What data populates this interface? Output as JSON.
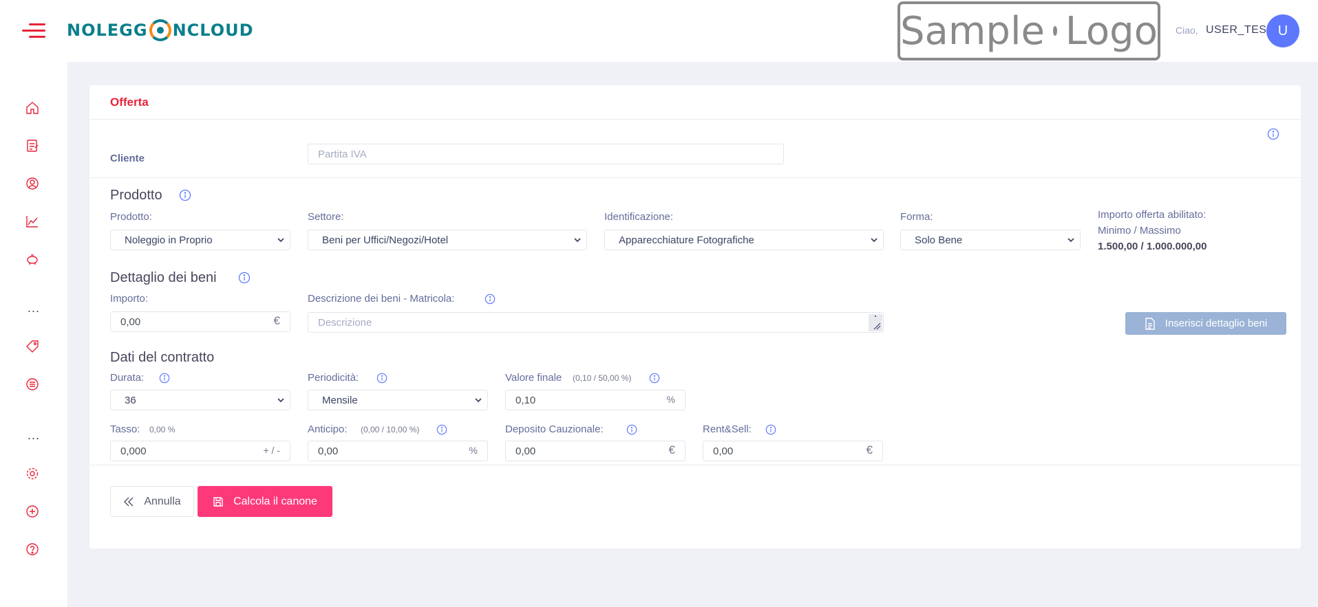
{
  "header": {
    "brand": "NOLEGG",
    "brand_end": "NCLOUD",
    "sample_logo_left": "Sample",
    "sample_logo_right": "Logo",
    "greeting": "Ciao,",
    "username": "USER_TEST",
    "avatar_letter": "U",
    "accent": "#e8233a",
    "avatar_color": "#5d78ff"
  },
  "sidebar": {
    "icons": [
      "home-icon",
      "orders-icon",
      "customer-icon",
      "chart-icon",
      "piggy-bank-icon",
      "more-icon",
      "tag-icon",
      "list-icon",
      "more-icon",
      "settings-icon",
      "add-circle-icon",
      "help-icon"
    ],
    "dots": "..."
  },
  "card": {
    "title": "Offerta",
    "cliente_label": "Cliente",
    "partita_iva_placeholder": "Partita IVA",
    "prodotto_section": "Prodotto",
    "prodotto_label": "Prodotto:",
    "prodotto_value": "Noleggio in Proprio",
    "settore_label": "Settore:",
    "settore_value": "Beni per Uffici/Negozi/Hotel",
    "identificazione_label": "Identificazione:",
    "identificazione_value": "Apparecchiature Fotografiche",
    "forma_label": "Forma:",
    "forma_value": "Solo Bene",
    "importo_abilitato_label": "Importo offerta abilitato:",
    "min_max_label": "Minimo / Massimo",
    "min_max_value": "1.500,00 / 1.000.000,00",
    "dettaglio_section": "Dettaglio dei beni",
    "importo_label": "Importo:",
    "importo_value": "0,00",
    "euro": "€",
    "descrizione_label": "Descrizione dei beni - Matricola:",
    "descrizione_placeholder": "Descrizione",
    "inserisci_button": "Inserisci dettaglio beni",
    "contratto_section": "Dati del contratto",
    "durata_label": "Durata:",
    "durata_value": "36",
    "periodicita_label": "Periodicità:",
    "periodicita_value": "Mensile",
    "valore_finale_label": "Valore finale",
    "valore_finale_range": "(0,10 / 50,00 %)",
    "valore_finale_value": "0,10",
    "percent": "%",
    "tasso_label": "Tasso:",
    "tasso_hint": "0,00 %",
    "tasso_value": "0,000",
    "tasso_suffix": "+ / -",
    "anticipo_label": "Anticipo:",
    "anticipo_range": "(0,00 / 10,00 %)",
    "anticipo_value": "0,00",
    "deposito_label": "Deposito Cauzionale:",
    "deposito_value": "0,00",
    "rentsell_label": "Rent&Sell:",
    "rentsell_value": "0,00",
    "annulla_button": "Annulla",
    "calcola_button": "Calcola il canone"
  }
}
